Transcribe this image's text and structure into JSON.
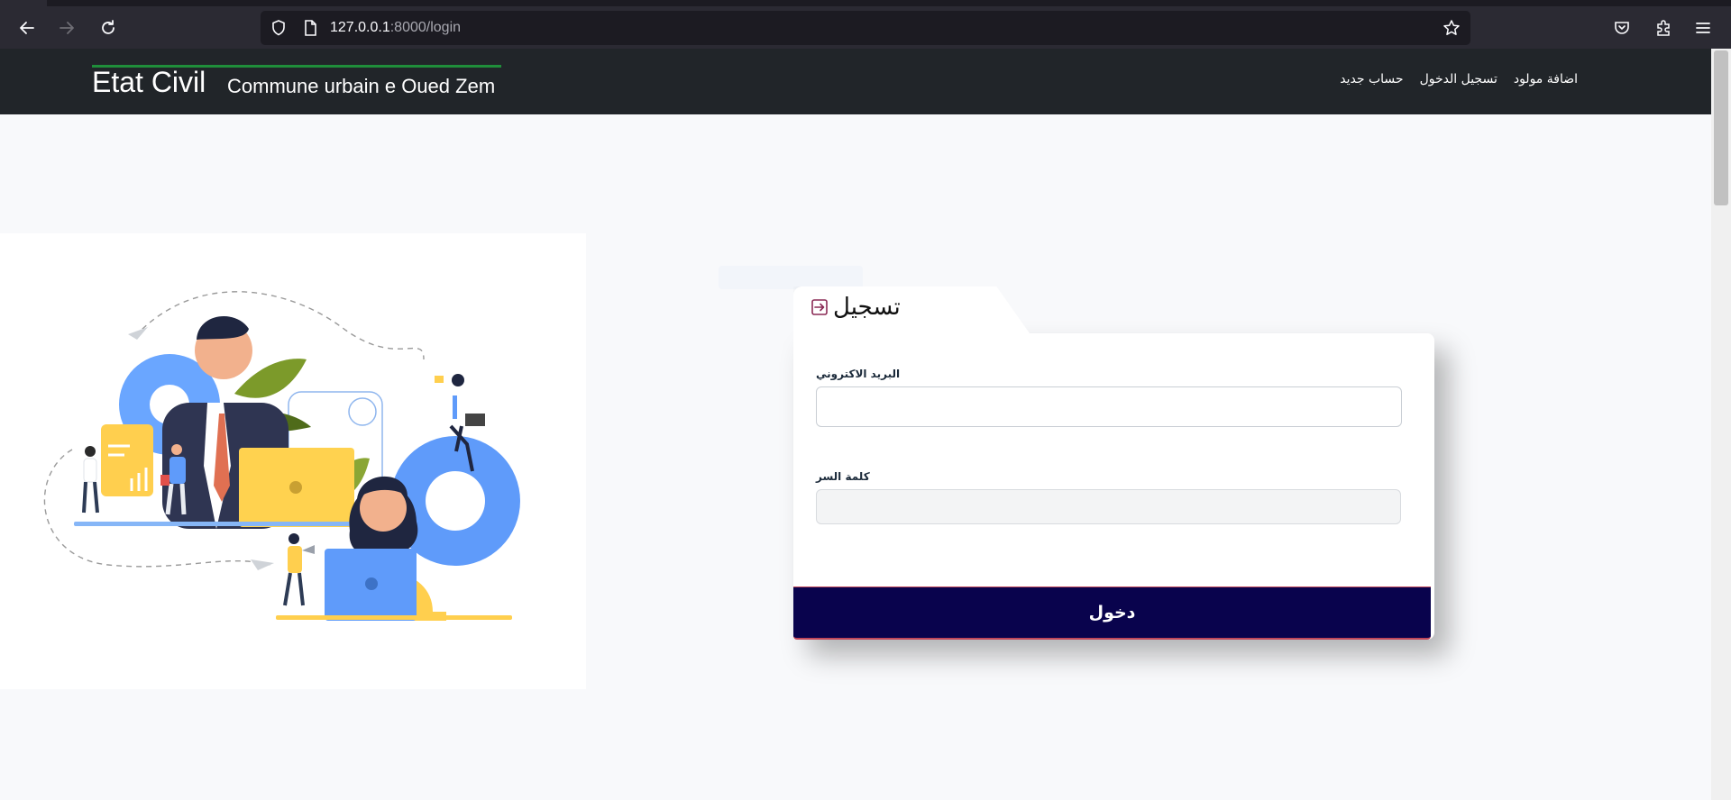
{
  "browser": {
    "url_host": "127.0.0.1",
    "url_path": ":8000/login",
    "icons": [
      "back-icon",
      "forward-icon",
      "reload-icon",
      "shield-icon",
      "page-icon",
      "star-icon",
      "pocket-icon",
      "extensions-icon",
      "menu-icon"
    ]
  },
  "navbar": {
    "brand": "Etat Civil",
    "subtitle": "Commune urbain e Oued Zem",
    "links": [
      {
        "label": "حساب جديد"
      },
      {
        "label": "تسجيل الدخول"
      },
      {
        "label": "اضافة مولود"
      }
    ]
  },
  "login": {
    "title": "تسجيل",
    "email_label": "البريد الاكتروني",
    "email_value": "",
    "password_label": "كلمة السر",
    "password_value": "",
    "submit_label": "دخول"
  },
  "colors": {
    "navbar": "#212529",
    "brand_underline": "#1f8e3a",
    "submit": "#09034d",
    "submit_border": "#c0475a"
  }
}
